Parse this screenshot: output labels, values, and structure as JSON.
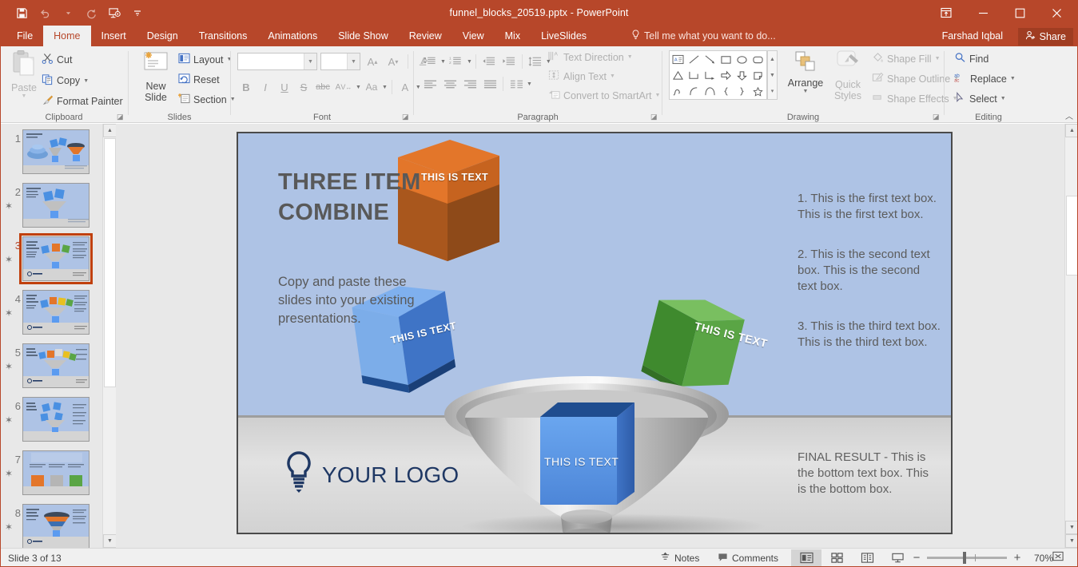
{
  "titlebar": {
    "document_title": "funnel_blocks_20519.pptx - PowerPoint",
    "qat": [
      {
        "name": "save-icon",
        "label": "Save"
      },
      {
        "name": "undo-icon",
        "label": "Undo"
      },
      {
        "name": "redo-icon",
        "label": "Redo"
      },
      {
        "name": "start-presentation-icon",
        "label": "Start From Beginning"
      },
      {
        "name": "customize-qat-icon",
        "label": "Customize Quick Access Toolbar"
      }
    ],
    "window_buttons": [
      {
        "name": "ribbon-display-options-icon",
        "label": "Ribbon Display Options"
      },
      {
        "name": "minimize-icon",
        "label": "Minimize"
      },
      {
        "name": "maximize-icon",
        "label": "Maximize"
      },
      {
        "name": "close-icon",
        "label": "Close"
      }
    ]
  },
  "tabs": [
    {
      "label": "File",
      "active": false
    },
    {
      "label": "Home",
      "active": true
    },
    {
      "label": "Insert",
      "active": false
    },
    {
      "label": "Design",
      "active": false
    },
    {
      "label": "Transitions",
      "active": false
    },
    {
      "label": "Animations",
      "active": false
    },
    {
      "label": "Slide Show",
      "active": false
    },
    {
      "label": "Review",
      "active": false
    },
    {
      "label": "View",
      "active": false
    },
    {
      "label": "Mix",
      "active": false
    },
    {
      "label": "LiveSlides",
      "active": false
    }
  ],
  "tellme": "Tell me what you want to do...",
  "account_name": "Farshad Iqbal",
  "share_label": "Share",
  "ribbon": {
    "groups": {
      "clipboard": {
        "label": "Clipboard",
        "paste": "Paste",
        "cut": "Cut",
        "copy": "Copy",
        "format_painter": "Format Painter"
      },
      "slides": {
        "label": "Slides",
        "new_slide": "New",
        "new_slide_2": "Slide",
        "layout": "Layout",
        "reset": "Reset",
        "section": "Section"
      },
      "font": {
        "label": "Font",
        "font_name_value": "",
        "font_size_value": "",
        "buttons": [
          "A",
          "A",
          "Clear Formatting",
          "B",
          "I",
          "U",
          "S",
          "abc",
          "AV",
          "Aa",
          "A"
        ]
      },
      "paragraph": {
        "label": "Paragraph",
        "text_direction": "Text Direction",
        "align_text": "Align Text",
        "convert_to_smartart": "Convert to SmartArt"
      },
      "drawing": {
        "label": "Drawing",
        "arrange": "Arrange",
        "quick_styles_1": "Quick",
        "quick_styles_2": "Styles",
        "shape_fill": "Shape Fill",
        "shape_outline": "Shape Outline",
        "shape_effects": "Shape Effects"
      },
      "editing": {
        "label": "Editing",
        "find": "Find",
        "replace": "Replace",
        "select": "Select"
      }
    }
  },
  "thumbnails": [
    {
      "number": "1",
      "starred": false,
      "selected": false
    },
    {
      "number": "2",
      "starred": true,
      "selected": false
    },
    {
      "number": "3",
      "starred": true,
      "selected": true
    },
    {
      "number": "4",
      "starred": true,
      "selected": false
    },
    {
      "number": "5",
      "starred": true,
      "selected": false
    },
    {
      "number": "6",
      "starred": true,
      "selected": false
    },
    {
      "number": "7",
      "starred": true,
      "selected": false
    },
    {
      "number": "8",
      "starred": true,
      "selected": false
    }
  ],
  "slide": {
    "title": "THREE ITEM COMBINE",
    "subtitle": "Copy and paste these slides into your existing presentations.",
    "bullets": [
      "1. This is the first text box. This is the first text box.",
      "2. This is the second text box. This is the second text box.",
      "3. This is the third text box. This is the third text box."
    ],
    "bottom_text": "FINAL RESULT - This is the bottom text box. This is the bottom box.",
    "logo_text": "YOUR LOGO",
    "cubes": [
      {
        "color": "#4a90e2",
        "label": "THIS IS TEXT",
        "position": "left"
      },
      {
        "color": "#e3762a",
        "label": "THIS IS TEXT",
        "position": "center"
      },
      {
        "color": "#5aa545",
        "label": "THIS IS TEXT",
        "position": "right"
      },
      {
        "color": "#5b9bf0",
        "label": "THIS IS TEXT",
        "position": "bottom"
      }
    ]
  },
  "statusbar": {
    "slide_counter": "Slide 3 of 13",
    "notes": "Notes",
    "comments": "Comments",
    "views": [
      {
        "name": "normal-view-icon",
        "active": true
      },
      {
        "name": "slide-sorter-view-icon",
        "active": false
      },
      {
        "name": "reading-view-icon",
        "active": false
      },
      {
        "name": "slideshow-view-icon",
        "active": false
      }
    ],
    "zoom_out": "−",
    "zoom_in": "+",
    "zoom_level": "70%",
    "fit_to_window": "fit-slide-icon"
  }
}
